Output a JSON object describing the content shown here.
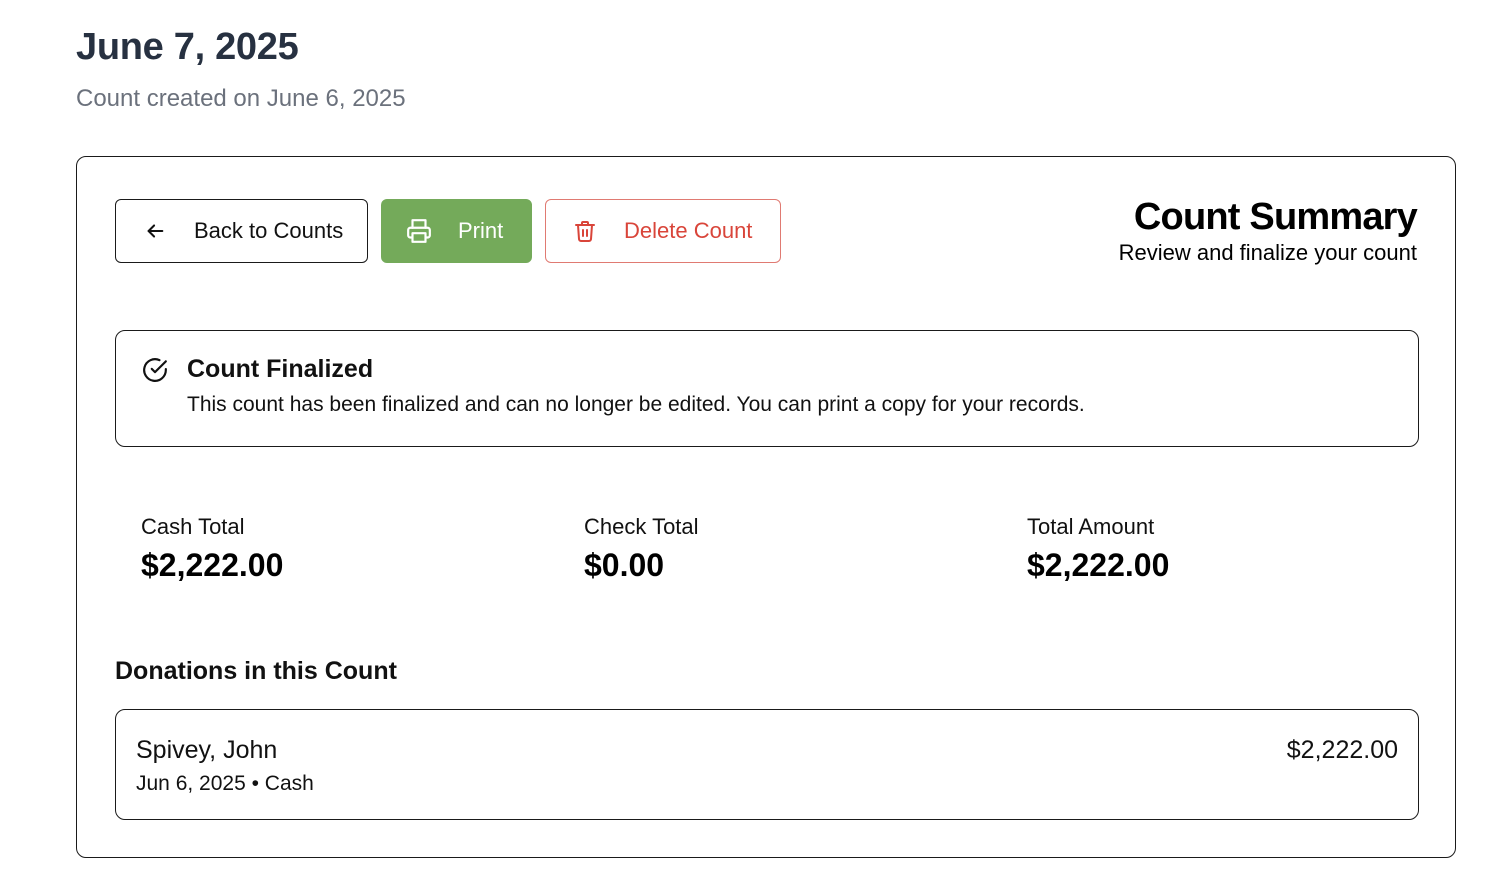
{
  "header": {
    "title": "June 7, 2025",
    "subtitle": "Count created on June 6, 2025"
  },
  "toolbar": {
    "back_label": "Back to Counts",
    "print_label": "Print",
    "delete_label": "Delete Count"
  },
  "summary": {
    "title": "Count Summary",
    "subtitle": "Review and finalize your count"
  },
  "notice": {
    "title": "Count Finalized",
    "text": "This count has been finalized and can no longer be edited. You can print a copy for your records."
  },
  "totals": [
    {
      "label": "Cash Total",
      "value": "$2,222.00"
    },
    {
      "label": "Check Total",
      "value": "$0.00"
    },
    {
      "label": "Total Amount",
      "value": "$2,222.00"
    }
  ],
  "donations": {
    "section_title": "Donations in this Count",
    "items": [
      {
        "name": "Spivey, John",
        "meta": "Jun 6, 2025 • Cash",
        "amount": "$2,222.00"
      }
    ]
  },
  "colors": {
    "print_button": "#74aa5a",
    "delete_text": "#d9453a",
    "delete_border": "#e07a72",
    "title": "#273141",
    "subtitle": "#6b717c"
  },
  "icons": {
    "back": "arrow-left-icon",
    "print": "printer-icon",
    "delete": "trash-icon",
    "notice": "check-circle-icon"
  }
}
